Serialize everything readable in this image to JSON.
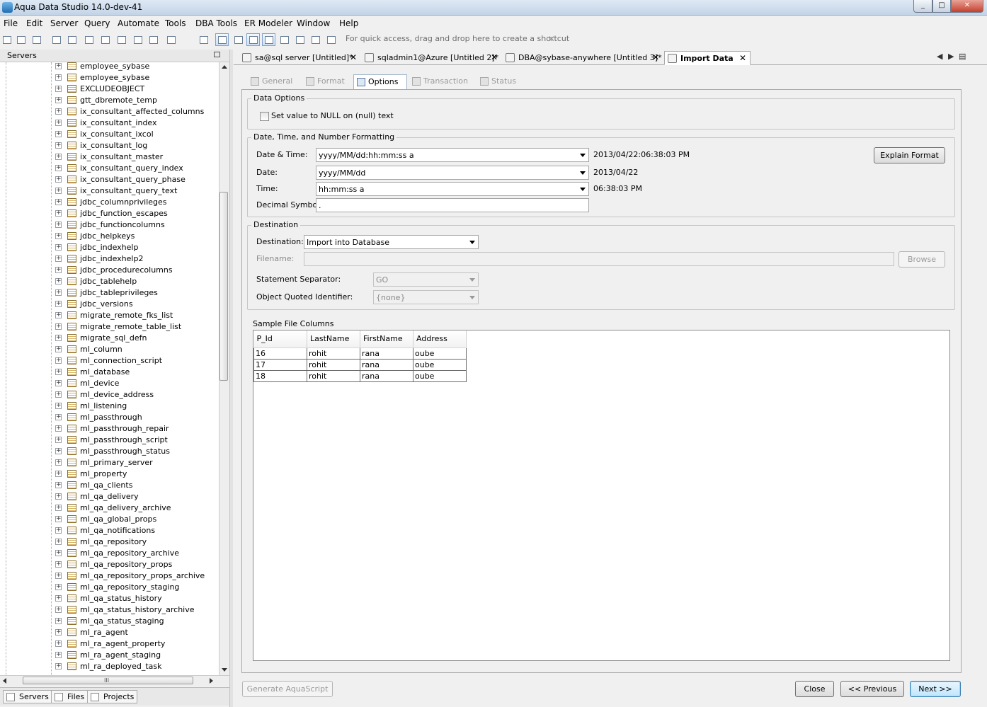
{
  "window": {
    "title": "Aqua Data Studio 14.0-dev-41",
    "minimize": "_",
    "maximize": "□",
    "close": "✕"
  },
  "menu": [
    "File",
    "Edit",
    "Server",
    "Query",
    "Automate",
    "Tools",
    "DBA Tools",
    "ER Modeler",
    "Window",
    "Help"
  ],
  "toolbar": {
    "quick_access": "For quick access, drag and drop here to create a shortcut",
    "quick_close": "✕"
  },
  "left_panel": {
    "title": "Servers",
    "items": [
      "employee_sybase",
      "employee_sybase",
      "EXCLUDEOBJECT",
      "gtt_dbremote_temp",
      "ix_consultant_affected_columns",
      "ix_consultant_index",
      "ix_consultant_ixcol",
      "ix_consultant_log",
      "ix_consultant_master",
      "ix_consultant_query_index",
      "ix_consultant_query_phase",
      "ix_consultant_query_text",
      "jdbc_columnprivileges",
      "jdbc_function_escapes",
      "jdbc_functioncolumns",
      "jdbc_helpkeys",
      "jdbc_indexhelp",
      "jdbc_indexhelp2",
      "jdbc_procedurecolumns",
      "jdbc_tablehelp",
      "jdbc_tableprivileges",
      "jdbc_versions",
      "migrate_remote_fks_list",
      "migrate_remote_table_list",
      "migrate_sql_defn",
      "ml_column",
      "ml_connection_script",
      "ml_database",
      "ml_device",
      "ml_device_address",
      "ml_listening",
      "ml_passthrough",
      "ml_passthrough_repair",
      "ml_passthrough_script",
      "ml_passthrough_status",
      "ml_primary_server",
      "ml_property",
      "ml_qa_clients",
      "ml_qa_delivery",
      "ml_qa_delivery_archive",
      "ml_qa_global_props",
      "ml_qa_notifications",
      "ml_qa_repository",
      "ml_qa_repository_archive",
      "ml_qa_repository_props",
      "ml_qa_repository_props_archive",
      "ml_qa_repository_staging",
      "ml_qa_status_history",
      "ml_qa_status_history_archive",
      "ml_qa_status_staging",
      "ml_ra_agent",
      "ml_ra_agent_property",
      "ml_ra_agent_staging",
      "ml_ra_deployed_task"
    ],
    "expander": "+",
    "hscroll_grip": "III",
    "bottom_tabs": [
      "Servers",
      "Files",
      "Projects"
    ]
  },
  "doc_tabs": [
    {
      "label": "sa@sql server [Untitled]*",
      "close": "✕"
    },
    {
      "label": "sqladmin1@Azure [Untitled 2]*",
      "close": "✕"
    },
    {
      "label": "DBA@sybase-anywhere [Untitled 3]*",
      "close": "✕"
    },
    {
      "label": "Import Data",
      "close": "✕"
    }
  ],
  "subtabs": [
    "General",
    "Format",
    "Options",
    "Transaction",
    "Status"
  ],
  "data_options": {
    "title": "Data Options",
    "null_checkbox_label": "Set value to NULL on (null) text"
  },
  "formatting": {
    "title": "Date, Time, and Number Formatting",
    "datetime_label": "Date & Time:",
    "datetime_value": "yyyy/MM/dd:hh:mm:ss a",
    "datetime_preview": "2013/04/22:06:38:03 PM",
    "date_label": "Date:",
    "date_value": "yyyy/MM/dd",
    "date_preview": "2013/04/22",
    "time_label": "Time:",
    "time_value": "hh:mm:ss a",
    "time_preview": "06:38:03 PM",
    "decimal_label": "Decimal Symbol:",
    "decimal_value": ".",
    "explain_button": "Explain Format"
  },
  "destination": {
    "title": "Destination",
    "destination_label": "Destination:",
    "destination_value": "Import into Database",
    "filename_label": "Filename:",
    "browse_button": "Browse",
    "separator_label": "Statement Separator:",
    "separator_value": "GO",
    "quoted_label": "Object Quoted Identifier:",
    "quoted_value": "{none}"
  },
  "sample": {
    "title": "Sample File Columns",
    "columns": [
      "P_Id",
      "LastName",
      "FirstName",
      "Address"
    ],
    "rows": [
      [
        "16",
        "rohit",
        "rana",
        "oube"
      ],
      [
        "17",
        "rohit",
        "rana",
        "oube"
      ],
      [
        "18",
        "rohit",
        "rana",
        "oube"
      ]
    ]
  },
  "footer": {
    "generate": "Generate AquaScript",
    "close": "Close",
    "previous": "<< Previous",
    "next": "Next >>"
  }
}
